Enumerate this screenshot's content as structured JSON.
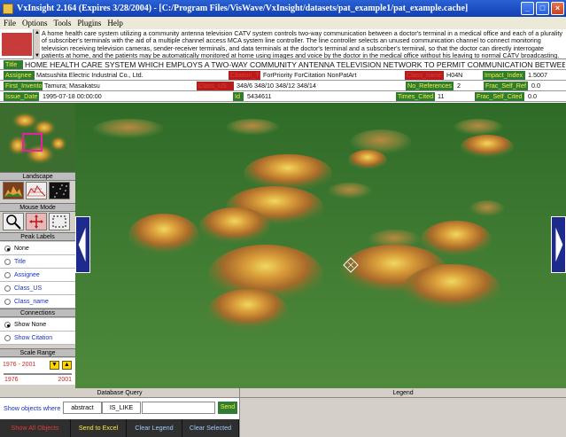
{
  "window": {
    "title": "VxInsight 2.164 (Expires 3/28/2004) - [C:/Program Files/VisWave/VxInsight/datasets/pat_example1/pat_example.cache]",
    "minimize": "_",
    "maximize": "□",
    "close": "×"
  },
  "menu": [
    "File",
    "Options",
    "Tools",
    "Plugins",
    "Help"
  ],
  "abstract": {
    "label": "Abstract",
    "text": "A home health care system utilizing a community antenna television CATV system controls two-way communication between a doctor's terminal in a medical office and each of a plurality of subscriber's terminals with the aid of a multiple channel access MCA system line controller. The line controller selects an unused communication channel to connect monitoring television receiving television cameras, sender-receiver terminals, and data terminals at the doctor's terminal and a subscriber's terminal, so that the doctor can directly interrogate patients at home, and the patients may be automatically monitored at home using images and voice by the doctor in the medical office without his leaving to normal CATV broadcasting."
  },
  "fields": {
    "title_label": "Title",
    "title_value": "HOME HEALTH CARE SYSTEM WHICH EMPLOYS A TWO-WAY COMMUNITY ANTENNA TELEVISION NETWORK TO PERMIT COMMUNICATION BETWEEN A DOCTOR AND PATIENTS A",
    "assignee_label": "Assignee",
    "assignee_value": "Matsushita Electric Industrial Co., Ltd.",
    "citation_label": "Citation_Type",
    "citation_value": "ForPriority ForCitation NonPatArt",
    "class_label": "Class_name",
    "class_value": "H04N",
    "impact_label": "Impact_Index",
    "impact_value": "1.5007",
    "inventor_label": "First_Inventor",
    "inventor_value": "Tamura; Masakatsu",
    "class_us_label": "Class_US",
    "class_us_value": "348/6  348/10  348/12  348/14",
    "norefs_label": "No_References",
    "norefs_value": "2",
    "fracselfref_label": "Frac_Self_Ref",
    "fracselfref_value": "0.0",
    "issue_label": "Issue_Date",
    "issue_value": "1995-07-18 00:00:00",
    "id_label": "Id",
    "id_value": "5434611",
    "timescited_label": "Times_Cited",
    "timescited_value": "11",
    "fracselfcited_label": "Frac_Self_Cited",
    "fracselfcited_value": "0.0"
  },
  "left": {
    "landscape": "Landscape",
    "mouse_mode": "Mouse Mode",
    "peak_labels": "Peak Labels",
    "peak_options": [
      "None",
      "Title",
      "Assignee",
      "Class_US",
      "Class_name"
    ],
    "peak_selected": 0,
    "connections": "Connections",
    "connection_options": [
      "Show None",
      "Show Citation"
    ],
    "connection_selected": 0,
    "scale_range": "Scale Range",
    "range_text": "1976 - 2001",
    "range_min": "1976",
    "range_max": "2001"
  },
  "bottom": {
    "db_query": "Database Query",
    "legend": "Legend",
    "show_where": "Show objects where",
    "field": "abstract",
    "op": "IS_LIKE",
    "query_value": "",
    "send": "Send",
    "actions": [
      "Show All Objects",
      "Send to Excel",
      "Clear Legend",
      "Clear Selected"
    ]
  },
  "colors": {
    "label_green": "#2e7d32",
    "label_yellow": "#ffeb3b",
    "label_red": "#b71c1c",
    "terrain": "#3d7a32",
    "nav_blue": "#1c2b8c"
  }
}
